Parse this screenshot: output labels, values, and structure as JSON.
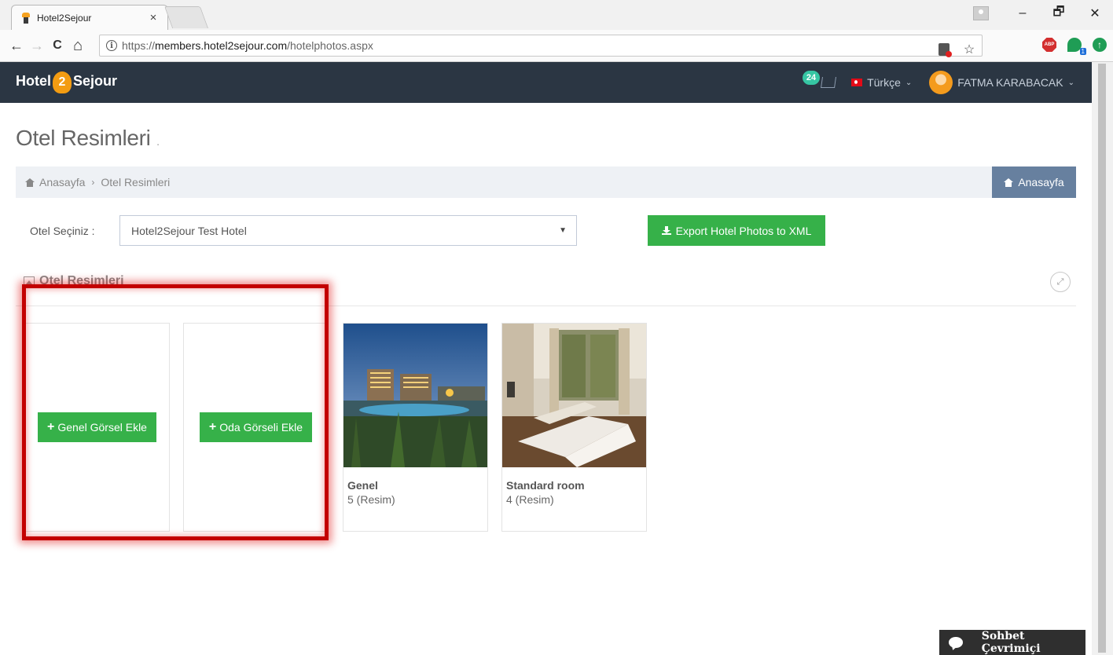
{
  "browser": {
    "tab_title": "Hotel2Sejour",
    "tab_close": "×",
    "url_prefix": "https://",
    "url_host": "members.hotel2sejour.com",
    "url_path": "/hotelphotos.aspx",
    "window_minimize": "–",
    "window_restore": "🗗",
    "window_close": "✕",
    "back": "←",
    "forward": "→",
    "reload": "C",
    "home": "⌂",
    "info": "i",
    "star": "☆",
    "abp_label": "ABP",
    "green_badge": "1",
    "up_arrow": "↑"
  },
  "header": {
    "logo_left": "Hotel",
    "logo_mid": "2",
    "logo_right": "Sejour",
    "cart_count": "24",
    "language": "Türkçe",
    "caret": "⌄",
    "user_name": "FATMA KARABACAK"
  },
  "page": {
    "title": "Otel Resimleri",
    "title_suffix": ".",
    "breadcrumb_home": "Anasayfa",
    "breadcrumb_sep": "›",
    "breadcrumb_current": "Otel Resimleri",
    "home_button": "Anasayfa"
  },
  "filter": {
    "label": "Otel Seçiniz :",
    "selected_hotel": "Hotel2Sejour Test Hotel",
    "select_arrow": "▼",
    "export_button": "Export Hotel Photos to XML"
  },
  "portlet": {
    "title": "Otel Resimleri",
    "expand": "⤢"
  },
  "cards": {
    "add_general": "Genel Görsel Ekle",
    "add_room": "Oda Görseli Ekle",
    "plus": "+",
    "albums": [
      {
        "name": "Genel",
        "count": "5 (Resim)"
      },
      {
        "name": "Standard room",
        "count": "4 (Resim)"
      }
    ]
  },
  "chat": {
    "label": "Sohbet Çevrimiçi"
  },
  "colors": {
    "header_bg": "#2b3643",
    "green": "#36b149",
    "breadcrumb_bg": "#eef1f5",
    "home_btn": "#67809f",
    "highlight": "#c30000"
  }
}
